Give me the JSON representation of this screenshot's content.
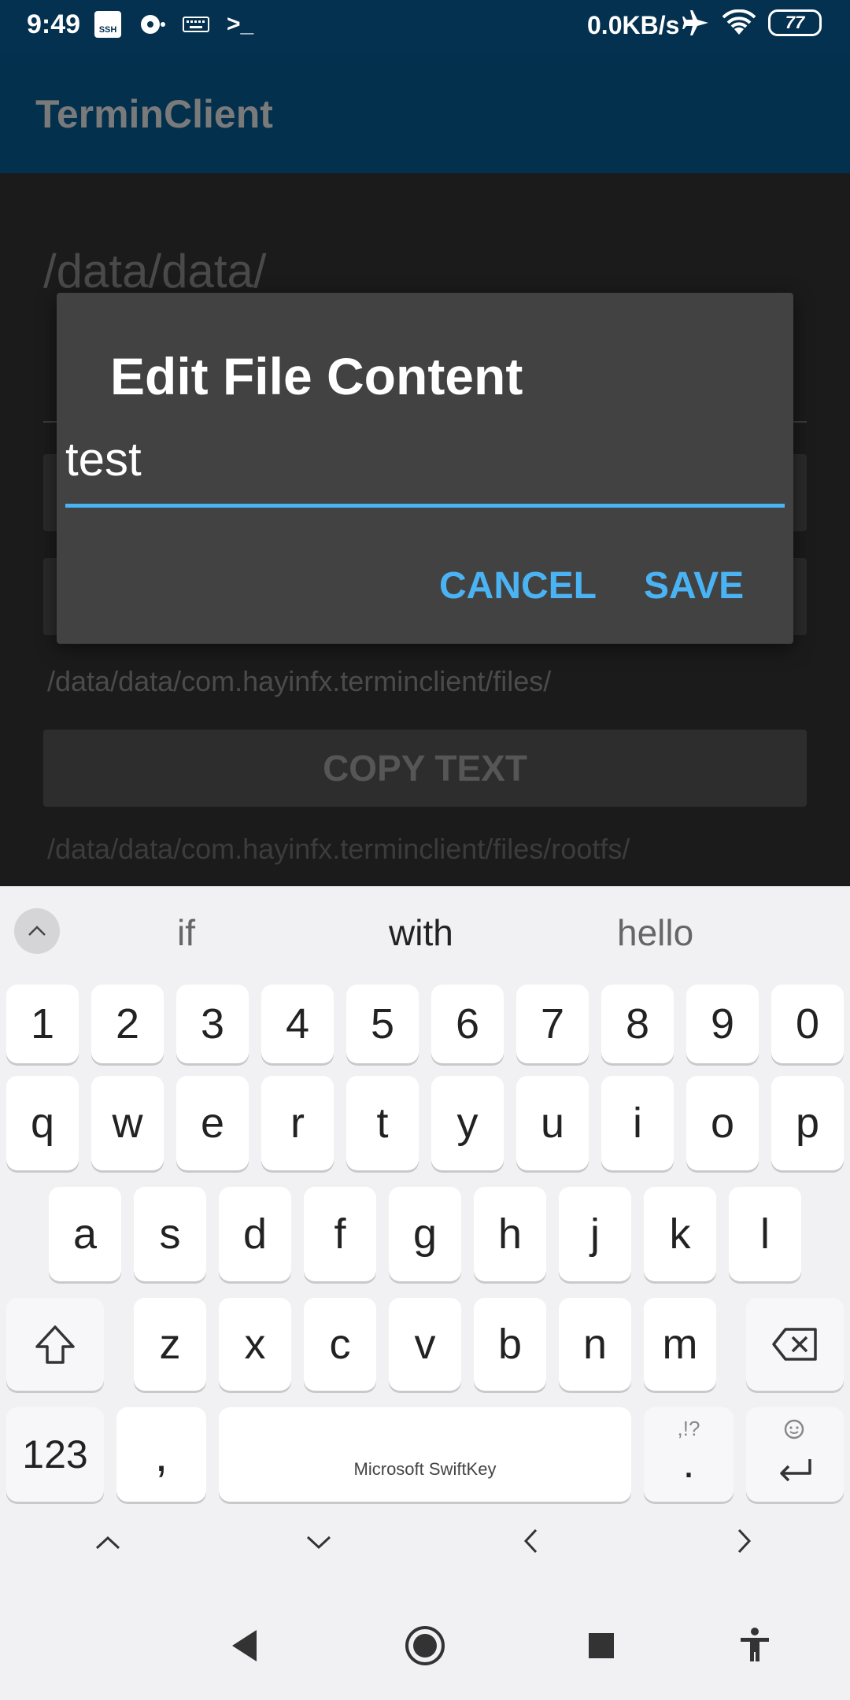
{
  "status": {
    "time": "9:49",
    "ssh_label": "SSH",
    "terminal_glyph": ">_",
    "speed": "0.0KB/s",
    "battery": "77"
  },
  "appbar": {
    "title": "TerminClient"
  },
  "background": {
    "path_big": "/data/data/",
    "path_small": "/data/data/com.hayinfx.terminclient/files/",
    "copy_button": "COPY TEXT",
    "path_cut": "/data/data/com.hayinfx.terminclient/files/rootfs/"
  },
  "dialog": {
    "title": "Edit File Content",
    "input_value": "test",
    "cancel": "CANCEL",
    "save": "SAVE",
    "accent": "#4ab3f4"
  },
  "keyboard": {
    "suggestions": [
      "if",
      "with",
      "hello"
    ],
    "row_numbers": [
      "1",
      "2",
      "3",
      "4",
      "5",
      "6",
      "7",
      "8",
      "9",
      "0"
    ],
    "row1": [
      "q",
      "w",
      "e",
      "r",
      "t",
      "y",
      "u",
      "i",
      "o",
      "p"
    ],
    "row2": [
      "a",
      "s",
      "d",
      "f",
      "g",
      "h",
      "j",
      "k",
      "l"
    ],
    "row3": [
      "z",
      "x",
      "c",
      "v",
      "b",
      "n",
      "m"
    ],
    "symbols_key": "123",
    "comma_key": ",",
    "space_label": "Microsoft SwiftKey",
    "period_sub": ",!?",
    "period_key": ".",
    "icons": {
      "shift": "shift-icon",
      "backspace": "backspace-icon",
      "enter": "enter-icon",
      "emoji": "emoji-icon",
      "expand": "chevron-up-icon"
    }
  },
  "nav": {
    "cursor_arrows": [
      "chevron-up-icon",
      "chevron-down-icon",
      "chevron-left-icon",
      "chevron-right-icon"
    ],
    "system": [
      "back-icon",
      "home-icon",
      "recents-icon",
      "accessibility-icon"
    ]
  }
}
